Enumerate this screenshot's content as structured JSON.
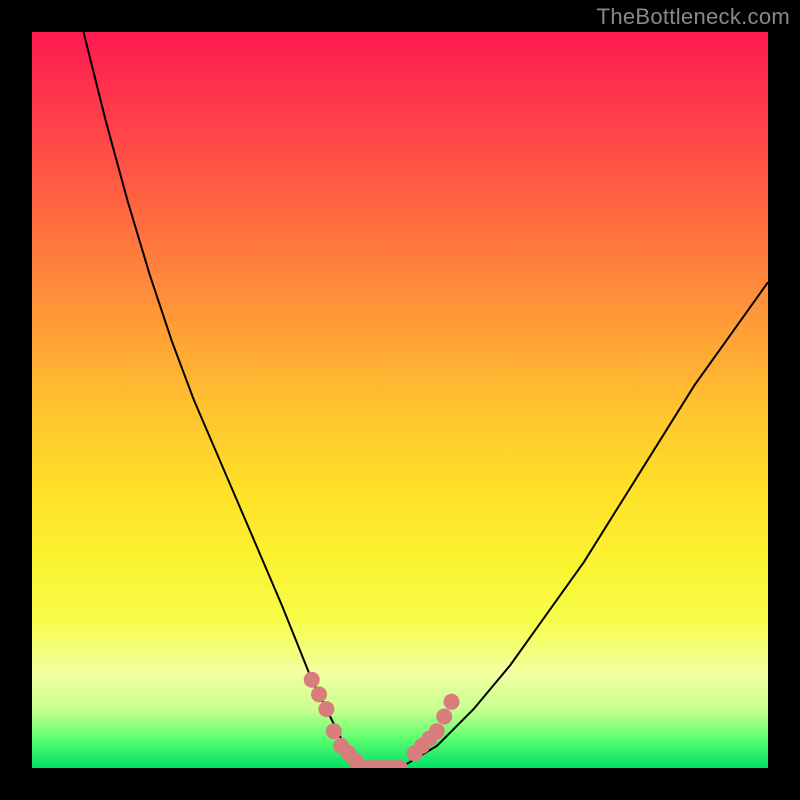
{
  "watermark": "TheBottleneck.com",
  "chart_data": {
    "type": "line",
    "title": "",
    "xlabel": "",
    "ylabel": "",
    "xlim": [
      0,
      100
    ],
    "ylim": [
      0,
      100
    ],
    "series": [
      {
        "name": "bottleneck-curve",
        "x": [
          7,
          10,
          13,
          16,
          19,
          22,
          25,
          28,
          31,
          34,
          36,
          38,
          40,
          42,
          44,
          46,
          50,
          55,
          60,
          65,
          70,
          75,
          80,
          85,
          90,
          95,
          100
        ],
        "y": [
          100,
          88,
          77,
          67,
          58,
          50,
          43,
          36,
          29,
          22,
          17,
          12,
          8,
          4,
          2,
          0,
          0,
          3,
          8,
          14,
          21,
          28,
          36,
          44,
          52,
          59,
          66
        ]
      }
    ],
    "scatter": {
      "name": "highlighted-range",
      "points": [
        {
          "x": 38,
          "y": 12
        },
        {
          "x": 39,
          "y": 10
        },
        {
          "x": 40,
          "y": 8
        },
        {
          "x": 41,
          "y": 5
        },
        {
          "x": 42,
          "y": 3
        },
        {
          "x": 43,
          "y": 2
        },
        {
          "x": 44,
          "y": 1
        },
        {
          "x": 45,
          "y": 0
        },
        {
          "x": 46,
          "y": 0
        },
        {
          "x": 47,
          "y": 0
        },
        {
          "x": 48,
          "y": 0
        },
        {
          "x": 49,
          "y": 0
        },
        {
          "x": 50,
          "y": 0
        },
        {
          "x": 52,
          "y": 2
        },
        {
          "x": 53,
          "y": 3
        },
        {
          "x": 54,
          "y": 4
        },
        {
          "x": 55,
          "y": 5
        },
        {
          "x": 56,
          "y": 7
        },
        {
          "x": 57,
          "y": 9
        }
      ]
    },
    "background_gradient_stops": [
      {
        "pos": 0,
        "color": "#ff1a4f"
      },
      {
        "pos": 50,
        "color": "#ffbf30"
      },
      {
        "pos": 80,
        "color": "#f7fd4a"
      },
      {
        "pos": 100,
        "color": "#00e066"
      }
    ]
  }
}
